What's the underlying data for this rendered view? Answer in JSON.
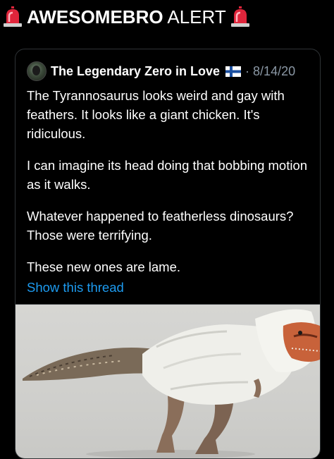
{
  "header": {
    "title_bold": "AWESOMEBRO",
    "title_light": "ALERT",
    "left_icon": "siren-emoji-icon",
    "right_icon": "siren-emoji-icon"
  },
  "tweet": {
    "author": "The Legendary Zero in Love",
    "flag_icon": "finland-flag-icon",
    "date": "· 8/14/20",
    "paragraphs": [
      "The Tyrannosaurus looks weird and gay with feathers. It looks like a giant chicken. It's ridiculous.",
      "I can imagine its head doing that bobbing motion as it walks.",
      "Whatever happened to featherless dinosaurs? Those were terrifying.",
      "These new ones are lame."
    ],
    "show_thread": "Show this thread"
  },
  "media": {
    "description_icon": "feathered-tyrannosaurus-image"
  },
  "colors": {
    "background": "#000000",
    "text": "#ffffff",
    "muted": "#8b98a5",
    "link": "#1d9bf0",
    "border": "#2f3336"
  }
}
